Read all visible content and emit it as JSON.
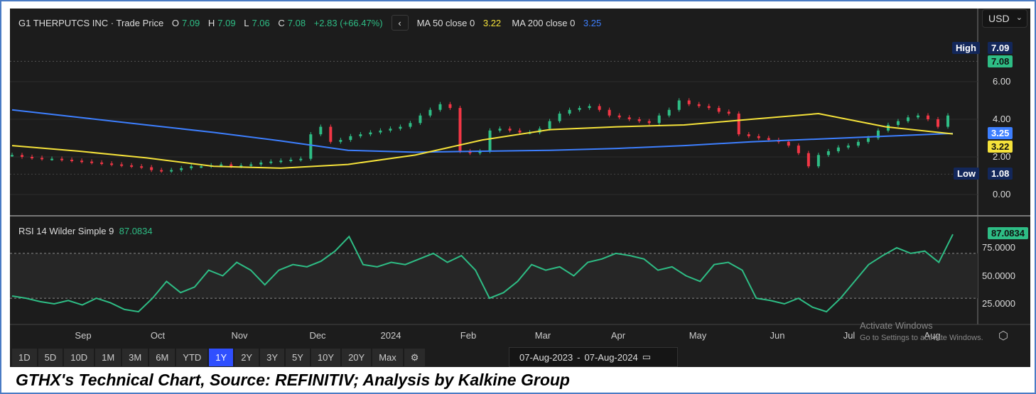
{
  "legend": {
    "name": "G1 THERPUTCS INC · Trade Price",
    "o_label": "O",
    "o": "7.09",
    "h_label": "H",
    "h": "7.09",
    "l_label": "L",
    "l": "7.06",
    "c_label": "C",
    "c": "7.08",
    "change": "+2.83 (+66.47%)",
    "ma50_label": "MA 50 close 0",
    "ma50": "3.22",
    "ma200_label": "MA 200 close 0",
    "ma200": "3.25"
  },
  "currency": "USD",
  "price_axis": [
    "6.00",
    "4.00",
    "2.00",
    "0.00"
  ],
  "tags": {
    "high_label": "High",
    "high": "7.09",
    "close": "7.08",
    "ma200": "3.25",
    "ma50": "3.22",
    "low_label": "Low",
    "low": "1.08"
  },
  "rsi": {
    "label": "RSI 14 Wilder Simple 9",
    "value": "87.0834",
    "axis": [
      "75.0000",
      "50.0000",
      "25.0000"
    ]
  },
  "x_axis": [
    "Sep",
    "Oct",
    "Nov",
    "Dec",
    "2024",
    "Feb",
    "Mar",
    "Apr",
    "May",
    "Jun",
    "Jul",
    "Aug"
  ],
  "ranges": [
    "1D",
    "5D",
    "10D",
    "1M",
    "3M",
    "6M",
    "YTD",
    "1Y",
    "2Y",
    "3Y",
    "5Y",
    "10Y",
    "20Y",
    "Max"
  ],
  "active_range": "1Y",
  "date_from": "07-Aug-2023",
  "date_sep": "-",
  "date_to": "07-Aug-2024",
  "watermark": {
    "line1": "Activate Windows",
    "line2": "Go to Settings to activate Windows."
  },
  "caption": "GTHX's Technical Chart, Source: REFINITIV; Analysis by Kalkine Group",
  "colors": {
    "up": "#2ebd85",
    "down": "#f23645",
    "ma50": "#f5e23a",
    "ma200": "#3d7fff",
    "rsi": "#2ebd85"
  },
  "chart_data": {
    "type": "line",
    "price_closes": [
      2.1,
      2.0,
      1.95,
      1.9,
      1.9,
      1.85,
      1.8,
      1.75,
      1.7,
      1.65,
      1.6,
      1.55,
      1.5,
      1.45,
      1.3,
      1.25,
      1.3,
      1.4,
      1.5,
      1.5,
      1.55,
      1.6,
      1.5,
      1.55,
      1.6,
      1.7,
      1.75,
      1.8,
      1.85,
      1.9,
      3.2,
      3.6,
      2.8,
      2.9,
      3.1,
      3.2,
      3.3,
      3.4,
      3.5,
      3.6,
      3.8,
      4.2,
      4.5,
      4.8,
      4.6,
      2.3,
      2.2,
      2.3,
      3.4,
      3.5,
      3.4,
      3.3,
      3.3,
      3.5,
      3.9,
      4.3,
      4.5,
      4.6,
      4.7,
      4.5,
      4.2,
      4.1,
      4.0,
      3.9,
      3.8,
      4.2,
      4.5,
      5.0,
      4.8,
      4.7,
      4.6,
      4.4,
      4.3,
      3.2,
      3.1,
      3.0,
      2.9,
      2.8,
      2.6,
      2.2,
      1.5,
      2.1,
      2.3,
      2.5,
      2.6,
      2.8,
      3.0,
      3.4,
      3.7,
      3.9,
      4.1,
      4.2,
      4.0,
      3.6,
      4.2
    ],
    "ma50": [
      2.6,
      2.3,
      1.95,
      1.5,
      1.4,
      1.6,
      2.1,
      2.9,
      3.45,
      3.6,
      3.7,
      4.0,
      4.3,
      3.6,
      3.22
    ],
    "ma200": [
      4.5,
      4.1,
      3.7,
      3.3,
      2.85,
      2.35,
      2.25,
      2.3,
      2.35,
      2.45,
      2.6,
      2.8,
      2.95,
      3.1,
      3.25
    ],
    "rsi": [
      32,
      30,
      27,
      25,
      28,
      24,
      30,
      26,
      20,
      18,
      30,
      45,
      35,
      40,
      55,
      50,
      62,
      55,
      42,
      55,
      60,
      58,
      63,
      72,
      85,
      60,
      58,
      62,
      60,
      65,
      70,
      62,
      68,
      55,
      30,
      35,
      45,
      60,
      55,
      58,
      50,
      62,
      65,
      70,
      68,
      65,
      55,
      58,
      50,
      45,
      60,
      62,
      55,
      30,
      28,
      25,
      30,
      22,
      18,
      30,
      45,
      60,
      68,
      75,
      70,
      72,
      62,
      87
    ],
    "ylim_price": [
      0,
      7.5
    ],
    "ylim_rsi": [
      15,
      90
    ],
    "rsi_levels": [
      70,
      30
    ]
  }
}
